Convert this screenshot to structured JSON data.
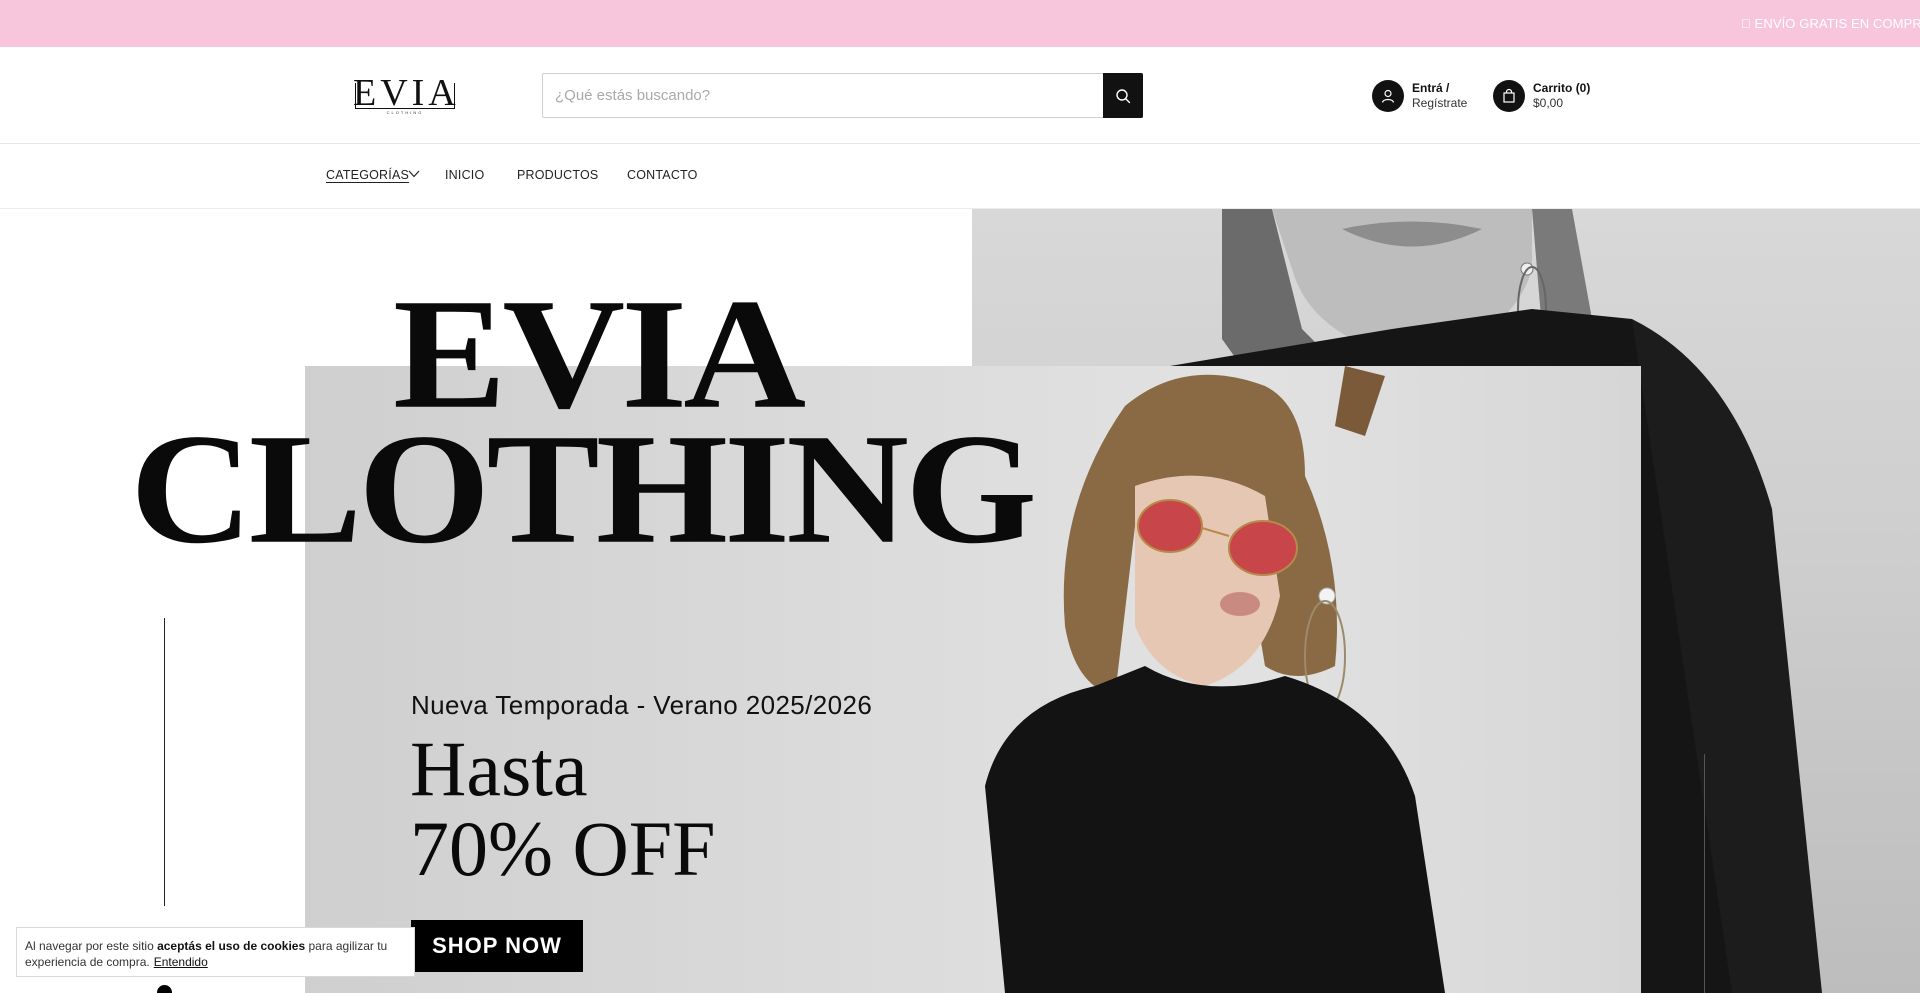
{
  "announcement": {
    "text": "\u0000 ENVÍO GRATIS EN COMPRAS S"
  },
  "header": {
    "logo": {
      "word": "EVIA",
      "sub": "CLOTHING"
    },
    "search": {
      "placeholder": "¿Qué estás buscando?",
      "value": "",
      "button_icon": "search-icon"
    },
    "account": {
      "line1": "Entrá /",
      "line2": "Regístrate",
      "icon": "user-icon"
    },
    "cart": {
      "line1": "Carrito",
      "count": "(0)",
      "total": "$0,00",
      "icon": "bag-icon"
    }
  },
  "nav": {
    "items": [
      {
        "label": "CATEGORÍAS",
        "has_dropdown": true
      },
      {
        "label": "INICIO"
      },
      {
        "label": "PRODUCTOS"
      },
      {
        "label": "CONTACTO"
      }
    ]
  },
  "hero": {
    "title_line1": "EVIA",
    "title_line2": "CLOTHING",
    "season": "Nueva Temporada - Verano 2025/2026",
    "promo_line1": "Hasta",
    "promo_line2": "70% OFF",
    "cta": "SHOP NOW"
  },
  "cookie": {
    "text_before": "Al navegar por este sitio ",
    "text_bold": "aceptás el uso de cookies",
    "text_after": " para agilizar tu experiencia de compra.",
    "link": "Entendido"
  },
  "colors": {
    "announcement_bg": "#f8c6dc",
    "accent": "#111111",
    "photo_grey": "#d8d8d8"
  }
}
